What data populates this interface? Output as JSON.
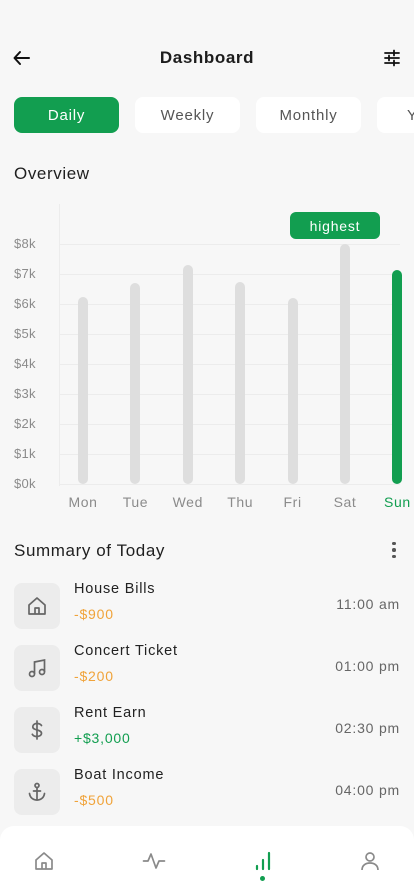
{
  "header": {
    "title": "Dashboard",
    "back_icon": "arrow-left-icon",
    "filter_icon": "sliders-icon"
  },
  "tabs": [
    {
      "label": "Daily",
      "active": true
    },
    {
      "label": "Weekly",
      "active": false
    },
    {
      "label": "Monthly",
      "active": false
    },
    {
      "label": "Yearly",
      "active": false
    }
  ],
  "overview": {
    "title": "Overview"
  },
  "chart_data": {
    "type": "bar",
    "categories": [
      "Mon",
      "Tue",
      "Wed",
      "Thu",
      "Fri",
      "Sat",
      "Sun"
    ],
    "values": [
      6250,
      6700,
      7300,
      6750,
      6200,
      8000,
      7150
    ],
    "ylim": [
      0,
      8000
    ],
    "y_ticks": [
      "$0k",
      "$1k",
      "$2k",
      "$3k",
      "$4k",
      "$5k",
      "$6k",
      "$7k",
      "$8k"
    ],
    "highlighted_category": "Sun",
    "annotation": "highest",
    "grid": true,
    "colors": {
      "bar": "#dedede",
      "highlight": "#129e50"
    }
  },
  "summary": {
    "title": "Summary of Today",
    "items": [
      {
        "name": "House Bills",
        "amount": "-$900",
        "type": "expense",
        "time": "11:00 am",
        "icon": "home-icon"
      },
      {
        "name": "Concert Ticket",
        "amount": "-$200",
        "type": "expense",
        "time": "01:00 pm",
        "icon": "music-icon"
      },
      {
        "name": "Rent Earn",
        "amount": "+$3,000",
        "type": "income",
        "time": "02:30 pm",
        "icon": "dollar-icon"
      },
      {
        "name": "Boat Income",
        "amount": "-$500",
        "type": "expense",
        "time": "04:00 pm",
        "icon": "anchor-icon"
      }
    ]
  },
  "bottom_nav": {
    "items": [
      "home-icon",
      "activity-icon",
      "stats-icon",
      "profile-icon"
    ],
    "active_index": 2
  },
  "colors": {
    "accent": "#129e50",
    "expense": "#f0a33a",
    "income": "#129e50"
  }
}
